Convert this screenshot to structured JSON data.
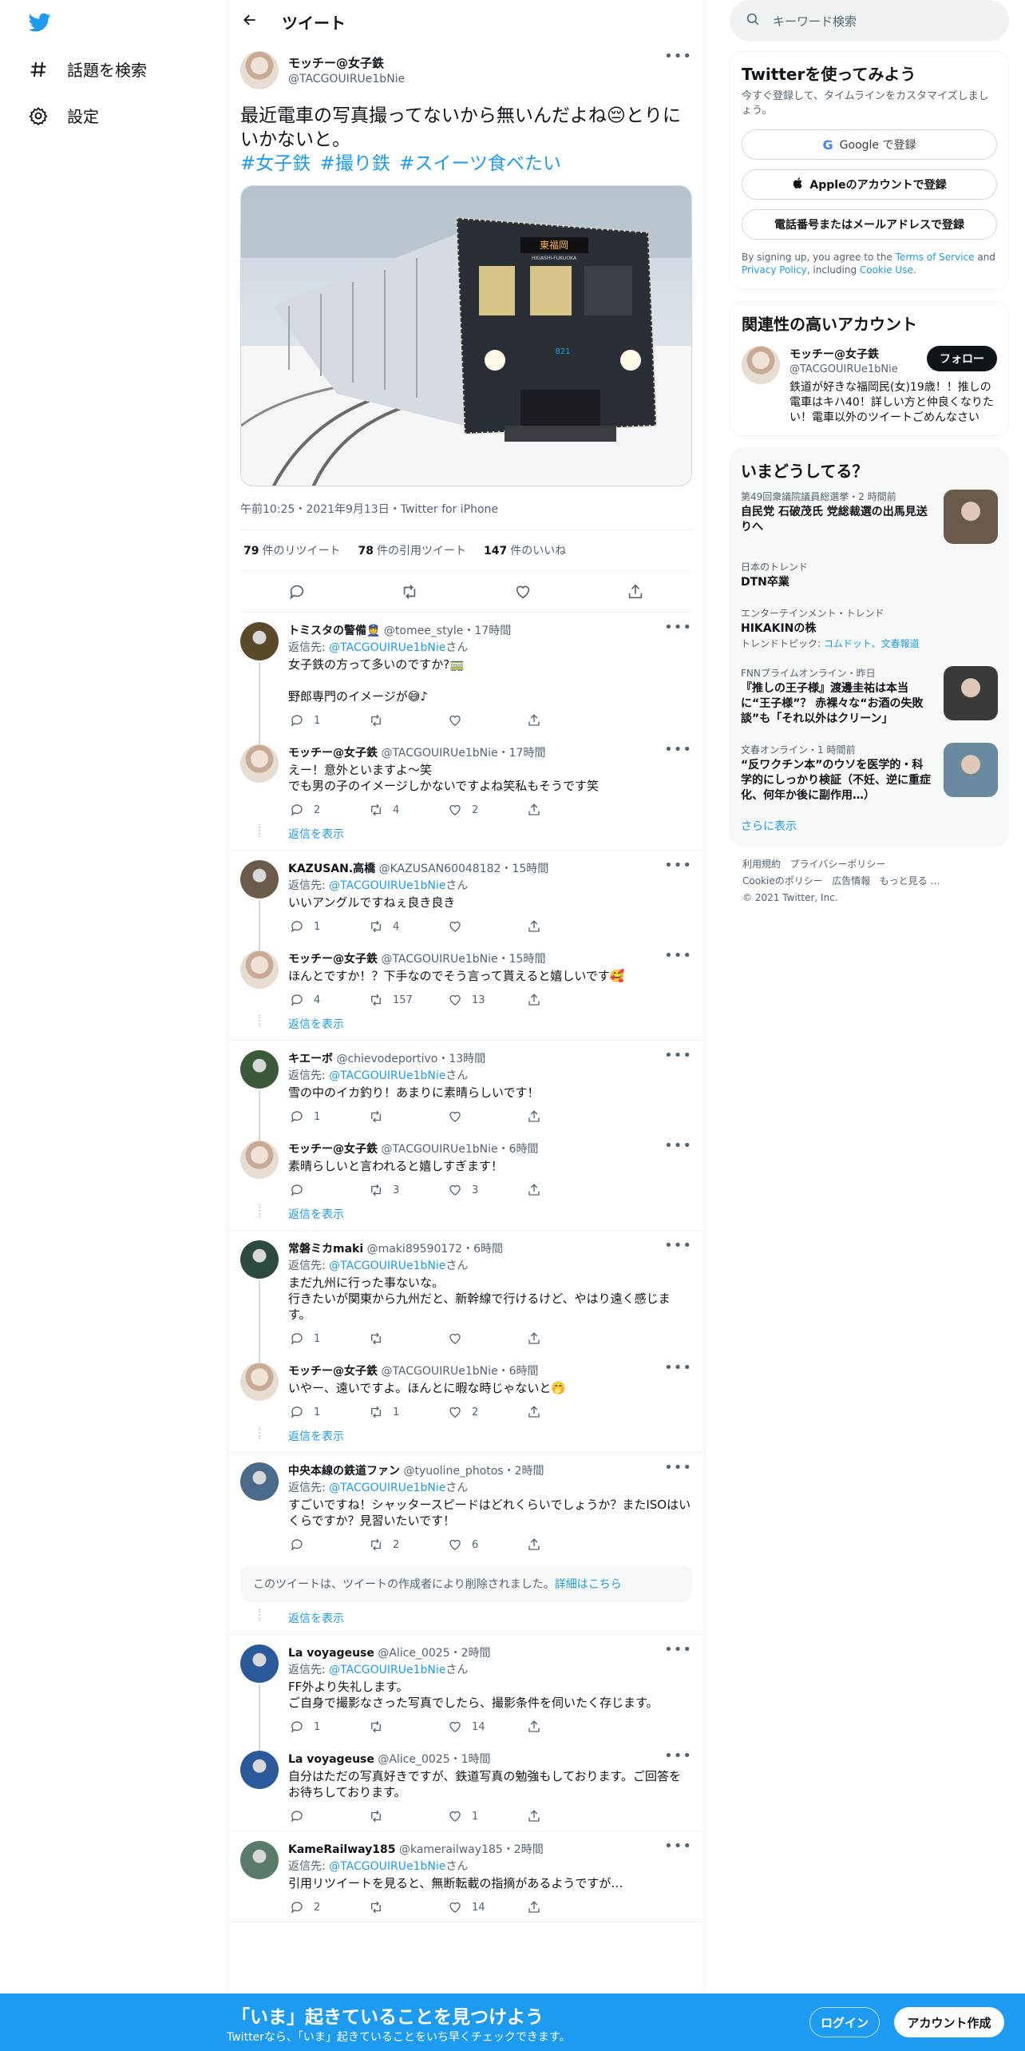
{
  "nav": {
    "explore_label": "話題を検索",
    "settings_label": "設定"
  },
  "header": {
    "title": "ツイート"
  },
  "main_tweet": {
    "name": "モッチー@女子鉄",
    "handle": "@TACGOUIRUe1bNie",
    "text": "最近電車の写真撮ってないから無いんだよね😔とりにいかないと。",
    "tags": "#女子鉄 #撮り鉄 #スイーツ食べたい",
    "train_sign": "東福岡",
    "train_sign_en": "HIGASHI-FUKUOKA",
    "train_number": "821",
    "time": "午前10:25・2021年9月13日・Twitter for iPhone",
    "retweets": "79",
    "retweets_label": "件のリツイート",
    "quotes": "78",
    "quotes_label": "件の引用ツイート",
    "likes": "147",
    "likes_label": "件のいいね"
  },
  "replying_prefix": "返信先:",
  "replying_suffix": "さん",
  "show_replies_label": "返信を表示",
  "deleted_notice": {
    "text": "このツイートは、ツイートの作成者により削除されました。",
    "link": "詳細はこちら"
  },
  "colors": {
    "accent": "#1d9bf0",
    "text": "#0f1419",
    "muted": "#536471"
  },
  "replies": [
    {
      "name": "トミスタの警備👮",
      "handle": "@tomee_style",
      "time": "・17時間",
      "reply_to": "@TACGOUIRUe1bNie",
      "text": "女子鉄の方って多いのですか?🚃\n\n野郎専門のイメージが😅♪",
      "replies": "1",
      "retweets": "",
      "likes": "",
      "avatar": "#5a4a2a"
    },
    {
      "name": "モッチー@女子鉄",
      "handle": "@TACGOUIRUe1bNie",
      "time": "・17時間",
      "reply_to": "",
      "text": "えー！意外といますよ〜笑\nでも男の子のイメージしかないですよね笑私もそうです笑",
      "replies": "2",
      "retweets": "4",
      "likes": "2",
      "avatar": "user"
    },
    {
      "name": "KAZUSAN.高橋",
      "handle": "@KAZUSAN60048182",
      "time": "・15時間",
      "reply_to": "@TACGOUIRUe1bNie",
      "text": "いいアングルですねぇ良き良き",
      "replies": "1",
      "retweets": "4",
      "likes": "",
      "avatar": "#6b5b4b"
    },
    {
      "name": "モッチー@女子鉄",
      "handle": "@TACGOUIRUe1bNie",
      "time": "・15時間",
      "reply_to": "",
      "text": "ほんとですか！？下手なのでそう言って貰えると嬉しいです🥰",
      "replies": "4",
      "retweets": "157",
      "likes": "13",
      "avatar": "user"
    },
    {
      "name": "キエーボ",
      "handle": "@chievodeportivo",
      "time": "・13時間",
      "reply_to": "@TACGOUIRUe1bNie",
      "text": "雪の中のイカ釣り！あまりに素晴らしいです！",
      "replies": "1",
      "retweets": "",
      "likes": "",
      "avatar": "#3a5a3a"
    },
    {
      "name": "モッチー@女子鉄",
      "handle": "@TACGOUIRUe1bNie",
      "time": "・6時間",
      "reply_to": "",
      "text": "素晴らしいと言われると嬉しすぎます！",
      "replies": "",
      "retweets": "3",
      "likes": "3",
      "avatar": "user"
    },
    {
      "name": "常磐ミカmaki",
      "handle": "@maki89590172",
      "time": "・6時間",
      "reply_to": "@TACGOUIRUe1bNie",
      "text": "まだ九州に行った事ないな。\n行きたいが関東から九州だと、新幹線で行けるけど、やはり遠く感じます。",
      "replies": "1",
      "retweets": "",
      "likes": "",
      "avatar": "#2d4a3e"
    },
    {
      "name": "モッチー@女子鉄",
      "handle": "@TACGOUIRUe1bNie",
      "time": "・6時間",
      "reply_to": "",
      "text": "いやー、遠いですよ。ほんとに暇な時じゃないと🤭",
      "replies": "1",
      "retweets": "1",
      "likes": "2",
      "avatar": "user"
    },
    {
      "name": "中央本線の鉄道ファン",
      "handle": "@tyuoline_photos",
      "time": "・2時間",
      "reply_to": "@TACGOUIRUe1bNie",
      "text": "すごいですね！シャッタースピードはどれくらいでしょうか？またISOはいくらですか？見習いたいです！",
      "replies": "",
      "retweets": "2",
      "likes": "6",
      "avatar": "#4a6a8a"
    },
    {
      "name": "La voyageuse",
      "handle": "@Alice_0025",
      "time": "・2時間",
      "reply_to": "@TACGOUIRUe1bNie",
      "text": "FF外より失礼します。\nご自身で撮影なさった写真でしたら、撮影条件を伺いたく存じます。",
      "replies": "1",
      "retweets": "",
      "likes": "14",
      "avatar": "#2a5a9a"
    },
    {
      "name": "La voyageuse",
      "handle": "@Alice_0025",
      "time": "・1時間",
      "reply_to": "",
      "text": "自分はただの写真好きですが、鉄道写真の勉強もしております。ご回答をお待ちしております。",
      "replies": "",
      "retweets": "",
      "likes": "1",
      "avatar": "#2a5a9a"
    },
    {
      "name": "KameRailway185",
      "handle": "@kamerailway185",
      "time": "・2時間",
      "reply_to": "@TACGOUIRUe1bNie",
      "text": "引用リツイートを見ると、無断転載の指摘があるようですが…",
      "replies": "2",
      "retweets": "",
      "likes": "14",
      "avatar": "#5a7a6a"
    }
  ],
  "right": {
    "search_placeholder": "キーワード検索",
    "signup_card": {
      "title": "Twitterを使ってみよう",
      "subtitle": "今すぐ登録して、タイムラインをカスタマイズしましょう。",
      "google": "Google で登録",
      "apple": "Appleのアカウントで登録",
      "phone": "電話番号またはメールアドレスで登録",
      "terms_a": "By signing up, you agree to the ",
      "terms_link1": "Terms of Service",
      "terms_b": " and ",
      "terms_link2": "Privacy Policy",
      "terms_c": ", including ",
      "terms_link3": "Cookie Use",
      "terms_d": "."
    },
    "related_card": {
      "title": "関連性の高いアカウント",
      "name": "モッチー@女子鉄",
      "handle": "@TACGOUIRUe1bNie",
      "follow": "フォロー",
      "bio": "鉄道が好きな福岡民(女)19歳！！推しの電車はキハ40！詳しい方と仲良くなりたい！電車以外のツイートごめんなさい"
    },
    "trends_card": {
      "title": "いまどうしてる？",
      "show_more": "さらに表示",
      "items": [
        {
          "meta": "第49回衆議院議員総選挙・2 時間前",
          "title": "自民党 石破茂氏 党総裁選の出馬見送りへ",
          "extra": "",
          "img": "#6b5a4a"
        },
        {
          "meta": "日本のトレンド",
          "title": "DTN卒業",
          "extra": "",
          "img": ""
        },
        {
          "meta": "エンターテインメント・トレンド",
          "title": "HIKAKINの株",
          "extra_prefix": "トレンドトピック: ",
          "extra": "コムドット、文春報道",
          "img": ""
        },
        {
          "meta": "FNNプライムオンライン・昨日",
          "title": "『推しの王子様』渡邊圭祐は本当に“王子様”？ 赤裸々な“お酒の失敗談”も「それ以外はクリーン」",
          "extra": "",
          "img": "#3a3a3a"
        },
        {
          "meta": "文春オンライン・1 時間前",
          "title": "“反ワクチン本”のウソを医学的・科学的にしっかり検証（不妊、逆に重症化、何年か後に副作用…）",
          "extra": "",
          "img": "#6a8aa0"
        }
      ]
    },
    "footer": {
      "l1": "利用規約",
      "l2": "プライバシーポリシー",
      "l3": "Cookieのポリシー",
      "l4": "広告情報",
      "l5": "もっと見る …",
      "copy": "© 2021 Twitter, Inc."
    }
  },
  "bottombar": {
    "title": "「いま」起きていることを見つけよう",
    "subtitle": "Twitterなら、「いま」起きていることをいち早くチェックできます。",
    "login": "ログイン",
    "signup": "アカウント作成"
  }
}
